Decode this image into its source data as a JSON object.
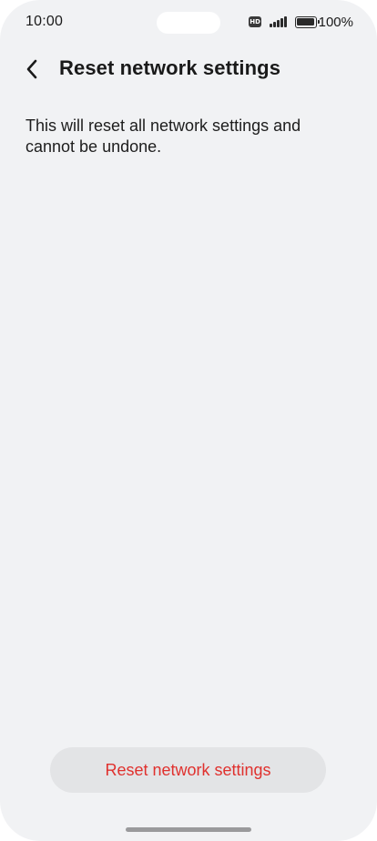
{
  "status_bar": {
    "time": "10:00",
    "network_badge": "HD",
    "battery_percent": "100%",
    "battery_level": 1.0,
    "icons": [
      "hd-icon",
      "signal-icon",
      "battery-icon"
    ]
  },
  "header": {
    "back_icon": "chevron-left-icon",
    "title": "Reset network settings"
  },
  "main": {
    "description": "This will reset all network settings and cannot be undone."
  },
  "footer": {
    "reset_button_label": "Reset network settings"
  },
  "colors": {
    "background": "#f1f2f4",
    "button_background": "#e3e4e6",
    "destructive_text": "#e0312e",
    "primary_text": "#1a1a1a"
  }
}
